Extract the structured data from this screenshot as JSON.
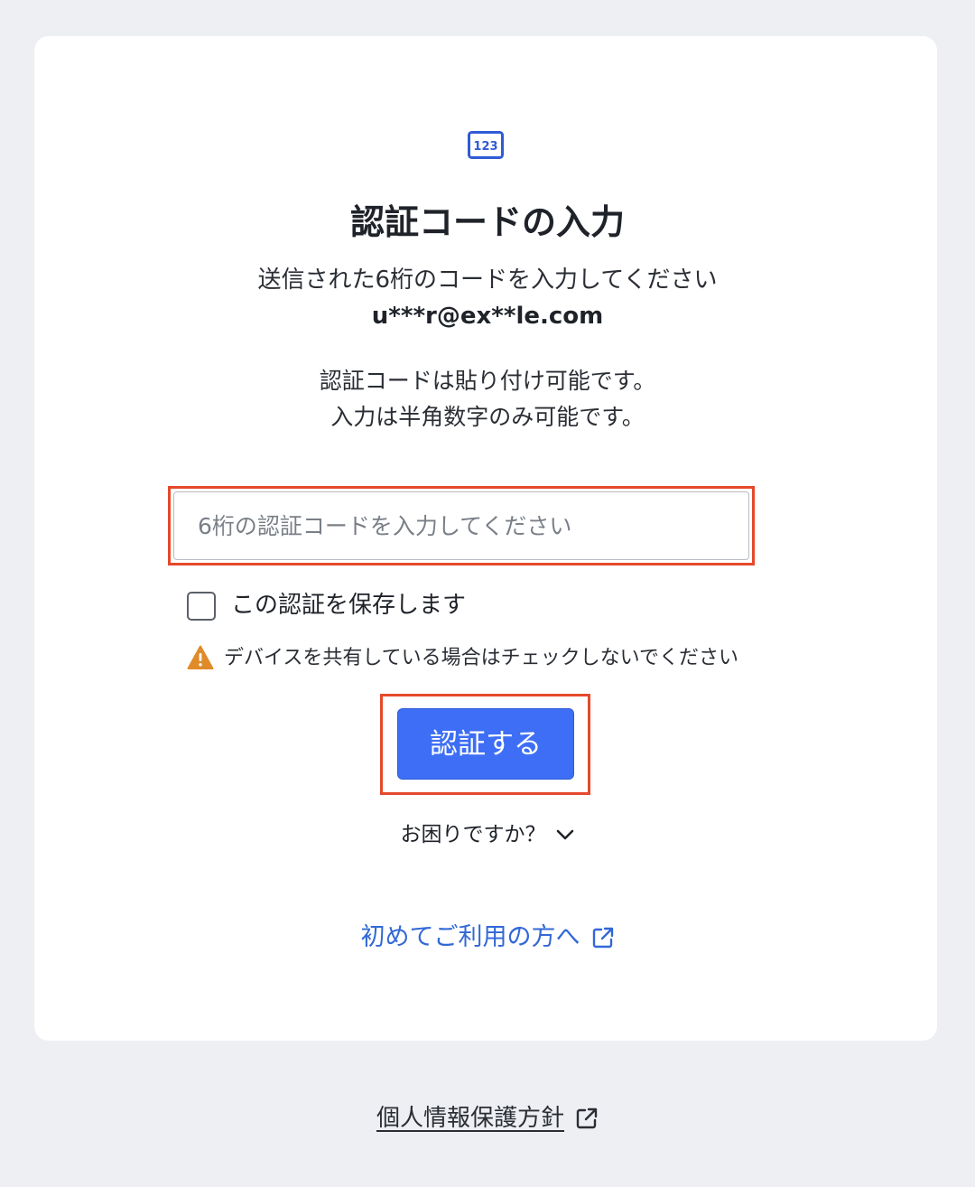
{
  "header": {
    "icon_text": "123",
    "title": "認証コードの入力",
    "subtitle": "送信された6桁のコードを入力してください",
    "masked_email": "u***r@ex**le.com"
  },
  "notes": {
    "line1": "認証コードは貼り付け可能です。",
    "line2": "入力は半角数字のみ可能です。"
  },
  "form": {
    "code_input": {
      "value": "",
      "placeholder": "6桁の認証コードを入力してください"
    },
    "remember_checkbox": {
      "label": "この認証を保存します",
      "checked": false
    },
    "warning_text": "デバイスを共有している場合はチェックしないでください",
    "submit_label": "認証する"
  },
  "help": {
    "label": "お困りですか？"
  },
  "links": {
    "first_time": "初めてご利用の方へ",
    "privacy_policy": "個人情報保護方針"
  },
  "icons": {
    "code": "numeric-code-icon",
    "warning": "warning-triangle-icon",
    "chevron": "chevron-down-icon",
    "external": "external-link-icon"
  },
  "colors": {
    "background": "#eeeff3",
    "card": "#ffffff",
    "primary_button": "#3d6ef5",
    "link": "#3268d6",
    "highlight_border": "#e5492b",
    "warning": "#e08a2a"
  }
}
